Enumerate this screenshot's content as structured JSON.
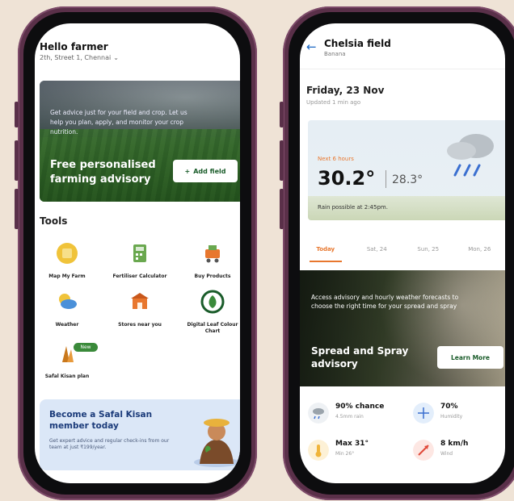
{
  "phone1": {
    "greeting": "Hello farmer",
    "location": "2th, Street 1, Chennai",
    "banner": {
      "small_text": "Get advice just for your field and crop. Let us help you plan, apply, and monitor your crop nutrition.",
      "title": "Free personalised farming advisory",
      "button_label": "Add field"
    },
    "tools_title": "Tools",
    "tools": [
      {
        "label": "Map My Farm",
        "icon": "map-icon"
      },
      {
        "label": "Fertiliser Calculator",
        "icon": "calculator-icon"
      },
      {
        "label": "Buy Products",
        "icon": "cart-icon"
      },
      {
        "label": "Weather",
        "icon": "weather-icon"
      },
      {
        "label": "Stores near you",
        "icon": "store-icon"
      },
      {
        "label": "Digital Leaf Colour Chart",
        "icon": "leaf-icon"
      },
      {
        "label": "Safal Kisan plan",
        "icon": "plan-icon",
        "badge": "New"
      }
    ],
    "member": {
      "title": "Become a Safal Kisan member today",
      "desc": "Get expert advice and regular check-ins from our team at just ₹199/year."
    },
    "carousel_active": 0
  },
  "phone2": {
    "field_name": "Chelsia field",
    "crop": "Banana",
    "date": "Friday, 23 Nov",
    "updated": "Updated 1 min ago",
    "weather": {
      "next_label": "Next 6 hours",
      "temp": "30.2°",
      "low": "28.3°",
      "rain_note": "Rain possible at 2:45pm."
    },
    "tabs": [
      "Today",
      "Sat, 24",
      "Sun, 25",
      "Mon, 26"
    ],
    "spray": {
      "small_text": "Access advisory and hourly weather forecasts to choose the right time for your spread and spray",
      "title": "Spread and Spray advisory",
      "button_label": "Learn More"
    },
    "metrics": [
      {
        "value": "90% chance",
        "label": "4.5mm rain",
        "icon": "rain-icon"
      },
      {
        "value": "70%",
        "label": "Humidity",
        "icon": "humidity-icon"
      },
      {
        "value": "Max 31°",
        "label": "Min 26°",
        "icon": "temperature-icon"
      },
      {
        "value": "8 km/h",
        "label": "Wind",
        "icon": "wind-icon"
      }
    ]
  },
  "colors": {
    "accent": "#e8772e",
    "brand_green": "#1a5c2a",
    "frame": "#5a3049"
  }
}
